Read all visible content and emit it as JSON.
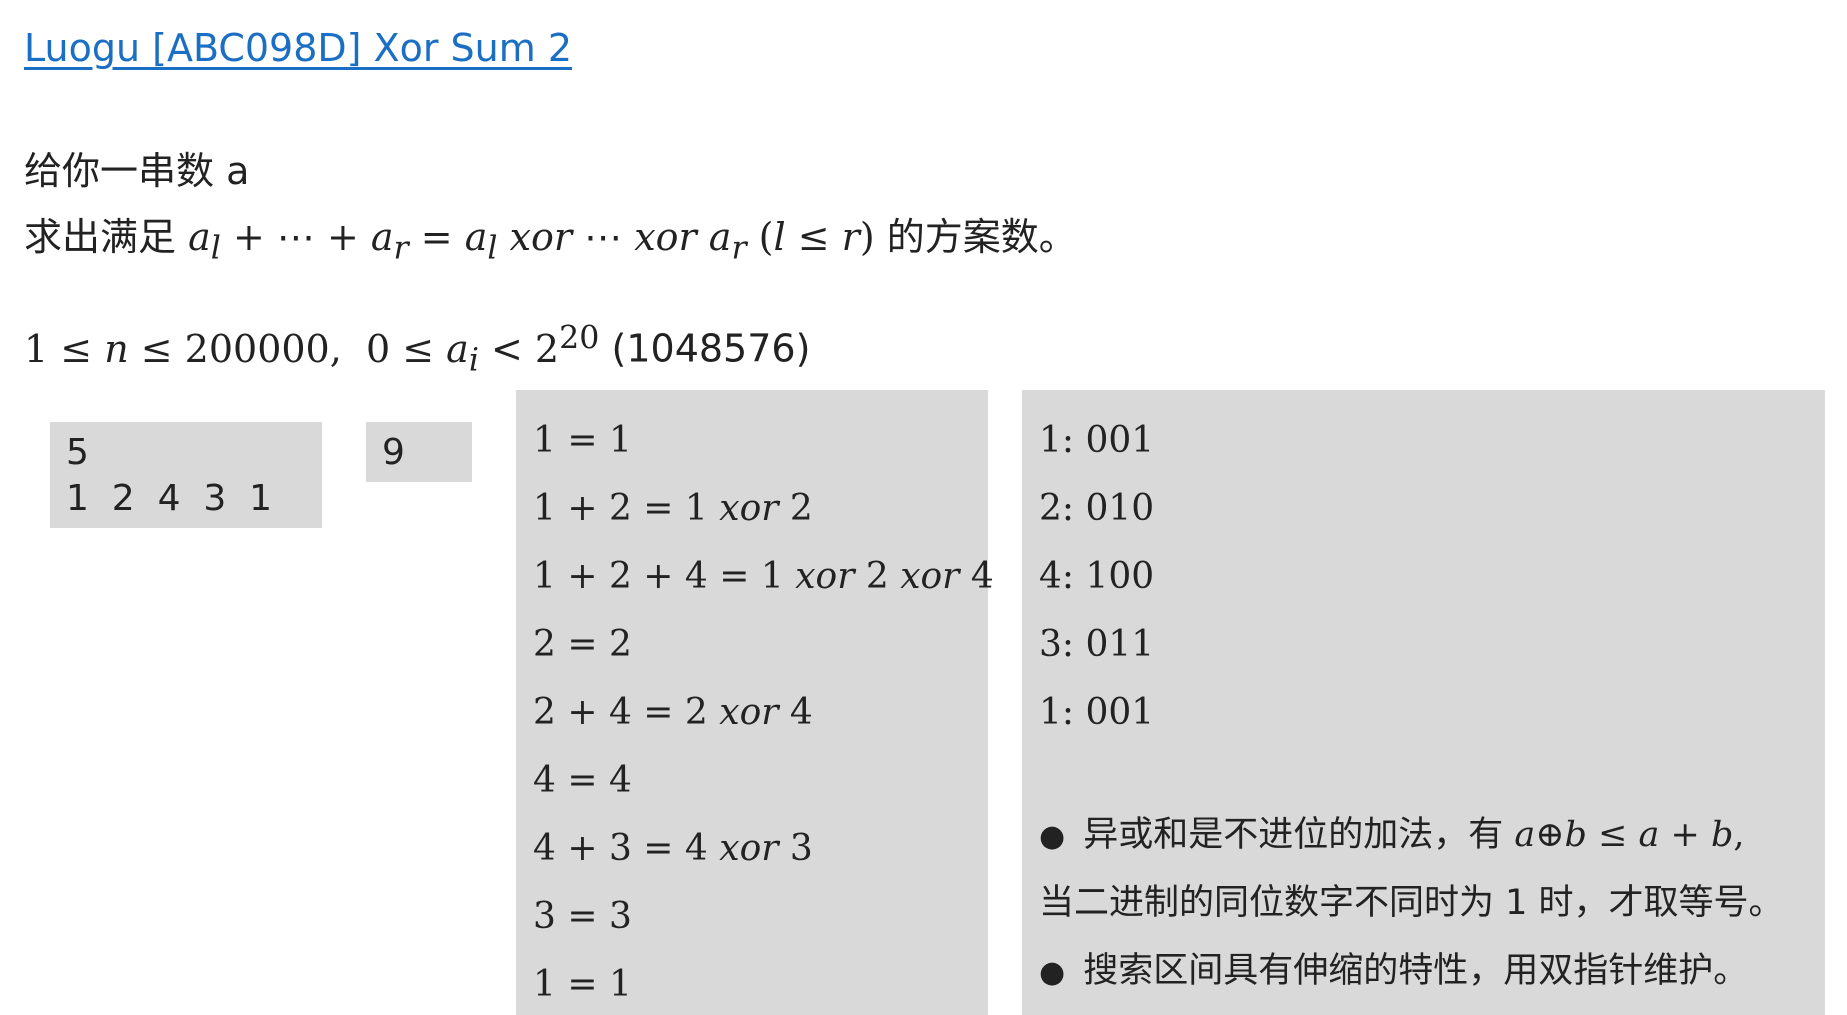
{
  "title": "Luogu [ABC098D] Xor Sum 2",
  "description": {
    "line1": "给你一串数 a",
    "line2_prefix": "求出满足",
    "line2_formula": "a_l + ⋯ + a_r = a_l xor ⋯ xor a_r (l ≤ r)",
    "line2_suffix": "的方案数。"
  },
  "constraints": {
    "formula": "1 ≤ n ≤ 200000, 0 ≤ a_i < 2^20",
    "note": "(1048576)"
  },
  "sample_input": {
    "line1": "5",
    "line2": "1  2  4  3  1"
  },
  "sample_output": "9",
  "calculations": [
    "1 = 1",
    "1 + 2 = 1 xor 2",
    "1 + 2 + 4 = 1 xor 2 xor 4",
    "2 = 2",
    "2 + 4 = 2 xor 4",
    "4 = 4",
    "4 + 3 = 4 xor 3",
    "3 = 3",
    "1 = 1"
  ],
  "binary": [
    "1: 001",
    "2: 010",
    "4: 100",
    "3: 011",
    "1: 001"
  ],
  "notes": {
    "bullet1_text": "异或和是不进位的加法，有",
    "bullet1_formula": "a⊕b ≤ a + b,",
    "line2": "当二进制的同位数字不同时为 1 时，才取等号。",
    "bullet2": "搜索区间具有伸缩的特性，用双指针维护。"
  }
}
